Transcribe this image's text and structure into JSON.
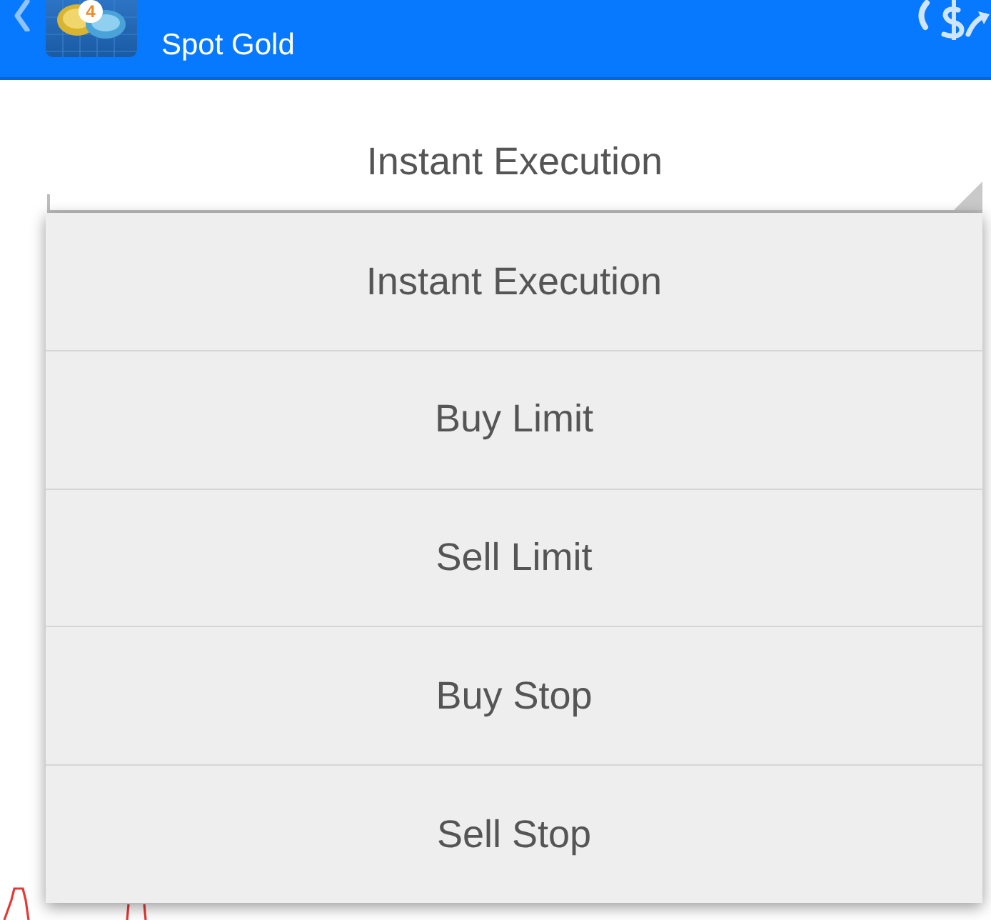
{
  "header": {
    "logo_badge": "4",
    "subtitle": "Spot Gold"
  },
  "order_type": {
    "value": "Instant Execution"
  },
  "dropdown": {
    "options": [
      "Instant Execution",
      "Buy Limit",
      "Sell Limit",
      "Buy Stop",
      "Sell Stop"
    ]
  }
}
